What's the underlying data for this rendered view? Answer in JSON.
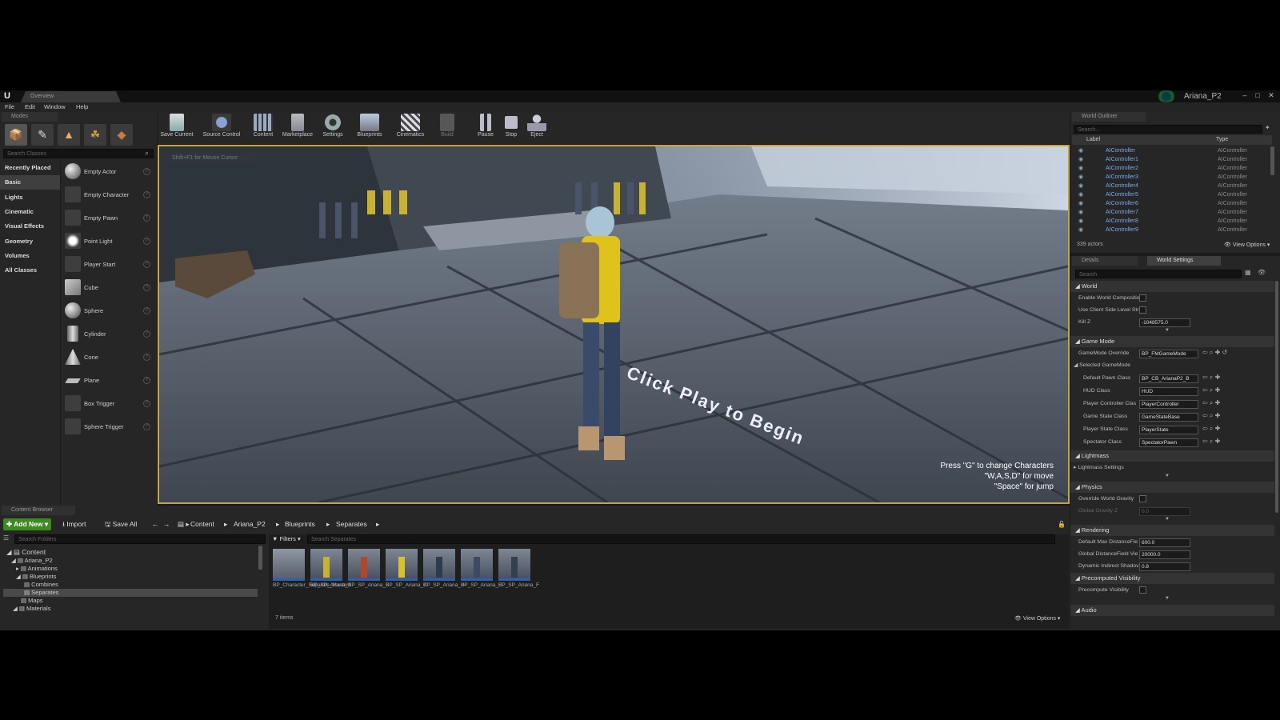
{
  "window": {
    "tab_title": "Overview",
    "project_name": "Ariana_P2",
    "controls": [
      "–",
      "□",
      "✕"
    ]
  },
  "menu": [
    "File",
    "Edit",
    "Window",
    "Help"
  ],
  "modes": {
    "tab_label": "Modes",
    "search_placeholder": "Search Classes",
    "categories": [
      "Recently Placed",
      "Basic",
      "Lights",
      "Cinematic",
      "Visual Effects",
      "Geometry",
      "Volumes",
      "All Classes"
    ],
    "items": [
      "Empty Actor",
      "Empty Character",
      "Empty Pawn",
      "Point Light",
      "Player Start",
      "Cube",
      "Sphere",
      "Cylinder",
      "Cone",
      "Plane",
      "Box Trigger",
      "Sphere Trigger"
    ]
  },
  "toolbar": [
    "Save Current",
    "Source Control",
    "Content",
    "Marketplace",
    "Settings",
    "Blueprints",
    "Cinematics",
    "Build",
    "Pause",
    "Stop",
    "Eject"
  ],
  "viewport": {
    "hint": "Shift+F1 for Mouse Cursor",
    "floor_text": "Click Play to Begin",
    "instructions": [
      "Press \"G\" to change  Characters",
      "\"W,A,S,D\" for move",
      "\"Space\" for jump"
    ]
  },
  "content_browser": {
    "tab_label": "Content Browser",
    "add_new": "Add New",
    "import": "Import",
    "save_all": "Save All",
    "breadcrumb": [
      "Content",
      "Ariana_P2",
      "Blueprints",
      "Separates"
    ],
    "folder_search": "Search Folders",
    "filters": "Filters",
    "asset_search": "Search Separates",
    "tree": [
      "Content",
      "Ariana_P2",
      "Animations",
      "Blueprints",
      "Combines",
      "Separates",
      "Maps",
      "Materials"
    ],
    "assets": [
      "BP_Character_Separate_Master",
      "BP_SP_Ariana_A",
      "BP_SP_Ariana_B",
      "BP_SP_Ariana_C",
      "BP_SP_Ariana_D",
      "BP_SP_Ariana_E",
      "BP_SP_Ariana_F"
    ],
    "count": "7 items",
    "view_options": "View Options"
  },
  "outliner": {
    "tab_label": "World Outliner",
    "search_placeholder": "Search...",
    "col_label": "Label",
    "col_type": "Type",
    "rows": [
      {
        "label": "AIController",
        "type": "AIController"
      },
      {
        "label": "AIController1",
        "type": "AIController"
      },
      {
        "label": "AIController2",
        "type": "AIController"
      },
      {
        "label": "AIController3",
        "type": "AIController"
      },
      {
        "label": "AIController4",
        "type": "AIController"
      },
      {
        "label": "AIController5",
        "type": "AIController"
      },
      {
        "label": "AIController6",
        "type": "AIController"
      },
      {
        "label": "AIController7",
        "type": "AIController"
      },
      {
        "label": "AIController8",
        "type": "AIController"
      },
      {
        "label": "AIController9",
        "type": "AIController"
      }
    ],
    "actor_count": "339 actors",
    "view_options": "View Options"
  },
  "details": {
    "tab_details": "Details",
    "tab_world": "World Settings",
    "search_placeholder": "Search",
    "world": {
      "title": "World",
      "enable_world_composition": "Enable World Compositio",
      "use_client_side": "Use Client Side Level Str",
      "kill_z_label": "Kill Z",
      "kill_z_value": "-1048575.0"
    },
    "game_mode": {
      "title": "Game Mode",
      "override_label": "GameMode Override",
      "override_value": "BP_FMGameMode",
      "selected_label": "Selected GameMode",
      "rows": [
        {
          "label": "Default Pawn Class",
          "value": "BP_CB_ArianaP2_B"
        },
        {
          "label": "HUD Class",
          "value": "HUD"
        },
        {
          "label": "Player Controller Clas",
          "value": "PlayerController"
        },
        {
          "label": "Game State Class",
          "value": "GameStateBase"
        },
        {
          "label": "Player State Class",
          "value": "PlayerState"
        },
        {
          "label": "Spectator Class",
          "value": "SpectatorPawn"
        }
      ]
    },
    "lightmass": {
      "title": "Lightmass",
      "settings": "Lightmass Settings"
    },
    "physics": {
      "title": "Physics",
      "override_gravity": "Override World Gravity",
      "global_gravity": "Global Gravity Z",
      "global_gravity_value": "0.0"
    },
    "rendering": {
      "title": "Rendering",
      "rows": [
        {
          "label": "Default Max DistanceFie",
          "value": "600.0"
        },
        {
          "label": "Global DistanceField Vie",
          "value": "20000.0"
        },
        {
          "label": "Dynamic Indirect Shadov",
          "value": "0.8"
        }
      ]
    },
    "precomputed": {
      "title": "Precomputed Visibility",
      "label": "Precompute Visibility"
    },
    "audio": {
      "title": "Audio"
    }
  },
  "colors": {
    "viewport_border": "#c8a43c",
    "add_new_green": "#3d8a1e",
    "selection_blue": "#2f5fb0",
    "outliner_blue": "#7aa8e8"
  }
}
